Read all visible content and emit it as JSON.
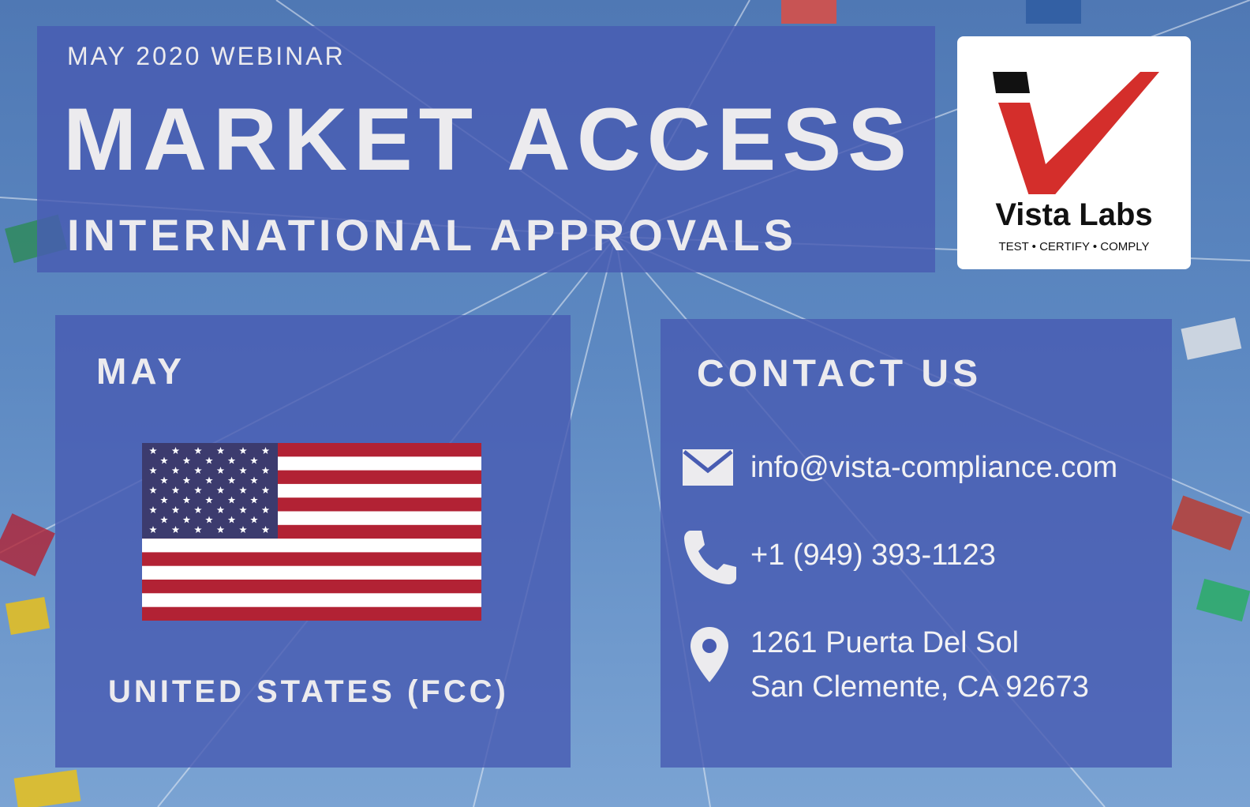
{
  "header": {
    "kicker": "MAY 2020 WEBINAR",
    "title": "MARKET ACCESS",
    "subtitle": "INTERNATIONAL APPROVALS"
  },
  "logo": {
    "name": "Vista Labs",
    "tagline": "TEST • CERTIFY • COMPLY",
    "icon": "checkmark-logo-icon",
    "accent_color": "#d42e2b",
    "dark_color": "#111111"
  },
  "left_panel": {
    "month": "MAY",
    "country": "UNITED STATES (FCC)",
    "flag_icon": "us-flag-icon"
  },
  "contact": {
    "heading": "CONTACT US",
    "email": "info@vista-compliance.com",
    "phone": "+1 (949) 393-1123",
    "address_line1": "1261 Puerta Del Sol",
    "address_line2": "San Clemente, CA 92673"
  },
  "colors": {
    "panel": "#485cb2",
    "text": "#ecebee",
    "flag_red": "#b22234",
    "flag_blue": "#3c3b6e"
  }
}
